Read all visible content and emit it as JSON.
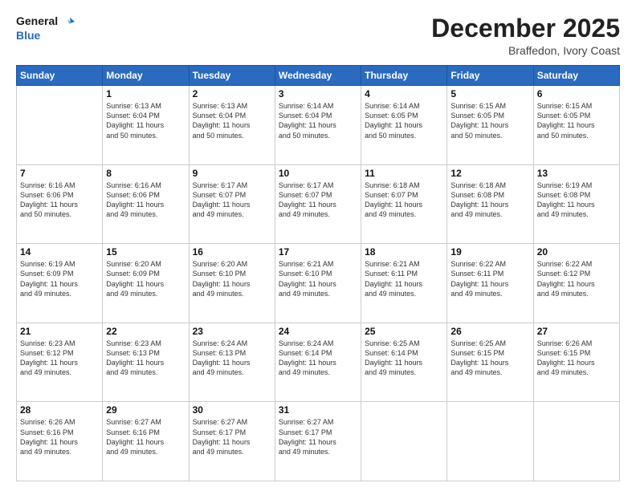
{
  "header": {
    "logo_line1": "General",
    "logo_line2": "Blue",
    "month": "December 2025",
    "location": "Braffedon, Ivory Coast"
  },
  "days_of_week": [
    "Sunday",
    "Monday",
    "Tuesday",
    "Wednesday",
    "Thursday",
    "Friday",
    "Saturday"
  ],
  "weeks": [
    [
      {
        "day": "",
        "info": ""
      },
      {
        "day": "1",
        "info": "Sunrise: 6:13 AM\nSunset: 6:04 PM\nDaylight: 11 hours\nand 50 minutes."
      },
      {
        "day": "2",
        "info": "Sunrise: 6:13 AM\nSunset: 6:04 PM\nDaylight: 11 hours\nand 50 minutes."
      },
      {
        "day": "3",
        "info": "Sunrise: 6:14 AM\nSunset: 6:04 PM\nDaylight: 11 hours\nand 50 minutes."
      },
      {
        "day": "4",
        "info": "Sunrise: 6:14 AM\nSunset: 6:05 PM\nDaylight: 11 hours\nand 50 minutes."
      },
      {
        "day": "5",
        "info": "Sunrise: 6:15 AM\nSunset: 6:05 PM\nDaylight: 11 hours\nand 50 minutes."
      },
      {
        "day": "6",
        "info": "Sunrise: 6:15 AM\nSunset: 6:05 PM\nDaylight: 11 hours\nand 50 minutes."
      }
    ],
    [
      {
        "day": "7",
        "info": "Sunrise: 6:16 AM\nSunset: 6:06 PM\nDaylight: 11 hours\nand 50 minutes."
      },
      {
        "day": "8",
        "info": "Sunrise: 6:16 AM\nSunset: 6:06 PM\nDaylight: 11 hours\nand 49 minutes."
      },
      {
        "day": "9",
        "info": "Sunrise: 6:17 AM\nSunset: 6:07 PM\nDaylight: 11 hours\nand 49 minutes."
      },
      {
        "day": "10",
        "info": "Sunrise: 6:17 AM\nSunset: 6:07 PM\nDaylight: 11 hours\nand 49 minutes."
      },
      {
        "day": "11",
        "info": "Sunrise: 6:18 AM\nSunset: 6:07 PM\nDaylight: 11 hours\nand 49 minutes."
      },
      {
        "day": "12",
        "info": "Sunrise: 6:18 AM\nSunset: 6:08 PM\nDaylight: 11 hours\nand 49 minutes."
      },
      {
        "day": "13",
        "info": "Sunrise: 6:19 AM\nSunset: 6:08 PM\nDaylight: 11 hours\nand 49 minutes."
      }
    ],
    [
      {
        "day": "14",
        "info": "Sunrise: 6:19 AM\nSunset: 6:09 PM\nDaylight: 11 hours\nand 49 minutes."
      },
      {
        "day": "15",
        "info": "Sunrise: 6:20 AM\nSunset: 6:09 PM\nDaylight: 11 hours\nand 49 minutes."
      },
      {
        "day": "16",
        "info": "Sunrise: 6:20 AM\nSunset: 6:10 PM\nDaylight: 11 hours\nand 49 minutes."
      },
      {
        "day": "17",
        "info": "Sunrise: 6:21 AM\nSunset: 6:10 PM\nDaylight: 11 hours\nand 49 minutes."
      },
      {
        "day": "18",
        "info": "Sunrise: 6:21 AM\nSunset: 6:11 PM\nDaylight: 11 hours\nand 49 minutes."
      },
      {
        "day": "19",
        "info": "Sunrise: 6:22 AM\nSunset: 6:11 PM\nDaylight: 11 hours\nand 49 minutes."
      },
      {
        "day": "20",
        "info": "Sunrise: 6:22 AM\nSunset: 6:12 PM\nDaylight: 11 hours\nand 49 minutes."
      }
    ],
    [
      {
        "day": "21",
        "info": "Sunrise: 6:23 AM\nSunset: 6:12 PM\nDaylight: 11 hours\nand 49 minutes."
      },
      {
        "day": "22",
        "info": "Sunrise: 6:23 AM\nSunset: 6:13 PM\nDaylight: 11 hours\nand 49 minutes."
      },
      {
        "day": "23",
        "info": "Sunrise: 6:24 AM\nSunset: 6:13 PM\nDaylight: 11 hours\nand 49 minutes."
      },
      {
        "day": "24",
        "info": "Sunrise: 6:24 AM\nSunset: 6:14 PM\nDaylight: 11 hours\nand 49 minutes."
      },
      {
        "day": "25",
        "info": "Sunrise: 6:25 AM\nSunset: 6:14 PM\nDaylight: 11 hours\nand 49 minutes."
      },
      {
        "day": "26",
        "info": "Sunrise: 6:25 AM\nSunset: 6:15 PM\nDaylight: 11 hours\nand 49 minutes."
      },
      {
        "day": "27",
        "info": "Sunrise: 6:26 AM\nSunset: 6:15 PM\nDaylight: 11 hours\nand 49 minutes."
      }
    ],
    [
      {
        "day": "28",
        "info": "Sunrise: 6:26 AM\nSunset: 6:16 PM\nDaylight: 11 hours\nand 49 minutes."
      },
      {
        "day": "29",
        "info": "Sunrise: 6:27 AM\nSunset: 6:16 PM\nDaylight: 11 hours\nand 49 minutes."
      },
      {
        "day": "30",
        "info": "Sunrise: 6:27 AM\nSunset: 6:17 PM\nDaylight: 11 hours\nand 49 minutes."
      },
      {
        "day": "31",
        "info": "Sunrise: 6:27 AM\nSunset: 6:17 PM\nDaylight: 11 hours\nand 49 minutes."
      },
      {
        "day": "",
        "info": ""
      },
      {
        "day": "",
        "info": ""
      },
      {
        "day": "",
        "info": ""
      }
    ]
  ]
}
